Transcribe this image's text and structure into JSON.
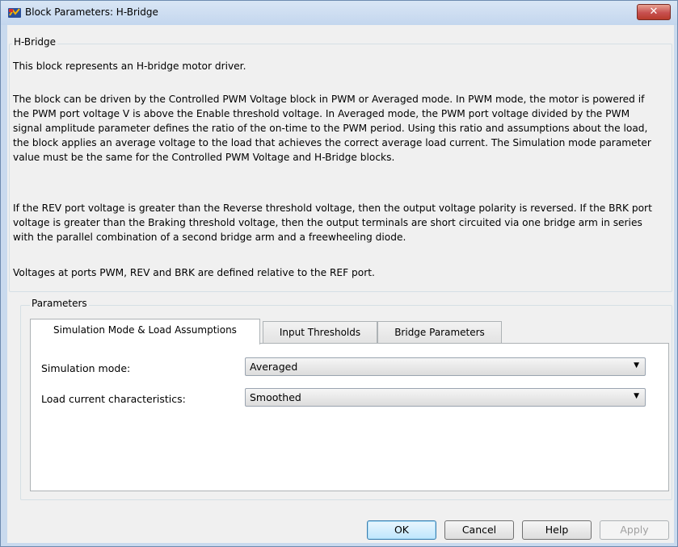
{
  "window": {
    "title": "Block Parameters: H-Bridge",
    "close_symbol": "✕"
  },
  "description_group": {
    "legend": "H-Bridge",
    "paragraphs": [
      "This block represents an H-bridge motor driver.",
      "The block can be driven by the Controlled PWM Voltage block in PWM or Averaged mode. In PWM mode, the motor is powered if the PWM port voltage V is above the Enable threshold voltage. In Averaged mode, the PWM port voltage divided by the PWM signal amplitude parameter defines the ratio of the on-time to the PWM period. Using this ratio and assumptions about the load, the block applies an average voltage to the load that achieves the correct average load current. The Simulation mode parameter value must be the same for the Controlled PWM Voltage and H-Bridge blocks.",
      "If the REV port voltage is greater than the Reverse threshold voltage, then the output voltage polarity is reversed. If the BRK port voltage is greater than the Braking threshold voltage, then the output terminals are short circuited via one bridge arm in series with the parallel combination of a second bridge arm and a freewheeling diode.",
      "Voltages at ports PWM, REV and BRK are defined relative to the REF port."
    ]
  },
  "parameters_group": {
    "legend": "Parameters",
    "tabs": [
      {
        "label": "Simulation Mode & Load Assumptions",
        "active": true
      },
      {
        "label": "Input Thresholds",
        "active": false
      },
      {
        "label": "Bridge Parameters",
        "active": false
      }
    ],
    "fields": [
      {
        "label": "Simulation mode:",
        "value": "Averaged"
      },
      {
        "label": "Load current characteristics:",
        "value": "Smoothed"
      }
    ]
  },
  "buttons": {
    "ok": "OK",
    "cancel": "Cancel",
    "help": "Help",
    "apply": "Apply"
  },
  "colors": {
    "title_bar": "#c9daee",
    "close_button": "#c75050",
    "client_bg": "#f0f0f0",
    "default_button_border": "#3c7fb1"
  },
  "icons": {
    "app": "simulink-block-icon",
    "close": "close-icon",
    "dropdown": "chevron-down-icon"
  }
}
